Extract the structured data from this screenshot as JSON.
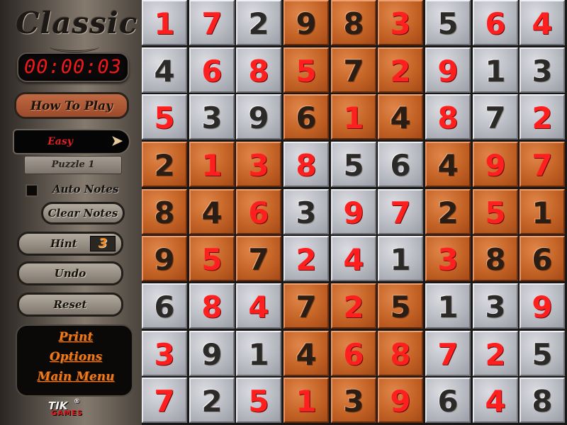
{
  "sidebar": {
    "title": "Classic",
    "timer": "00:00:03",
    "how_to_play": "How To Play",
    "difficulty": "Easy",
    "difficulty_arrow_icon": "arrow-right-icon",
    "puzzle_label": "Puzzle   1",
    "auto_notes": {
      "label": "Auto Notes",
      "checked": false
    },
    "clear_notes": "Clear Notes",
    "hint": {
      "label": "Hint",
      "count": "3"
    },
    "undo": "Undo",
    "reset": "Reset",
    "menu": {
      "print": "Print",
      "options": "Options",
      "main_menu": "Main Menu"
    },
    "logo": {
      "tik": "TIK",
      "reg": "®",
      "games": "GAMES"
    }
  },
  "colors": {
    "entered_digit": "#ff1f1f",
    "given_digit": "#2c2a28",
    "light_tile": "#b9bbc3",
    "dark_tile": "#c46326",
    "timer_text": "#f01818",
    "menu_link": "#f07a1a"
  },
  "board": {
    "rows": [
      [
        "1",
        "7",
        "2",
        "9",
        "8",
        "3",
        "5",
        "6",
        "4"
      ],
      [
        "4",
        "6",
        "8",
        "5",
        "7",
        "2",
        "9",
        "1",
        "3"
      ],
      [
        "5",
        "3",
        "9",
        "6",
        "1",
        "4",
        "8",
        "7",
        "2"
      ],
      [
        "2",
        "1",
        "3",
        "8",
        "5",
        "6",
        "4",
        "9",
        "7"
      ],
      [
        "8",
        "4",
        "6",
        "3",
        "9",
        "7",
        "2",
        "5",
        "1"
      ],
      [
        "9",
        "5",
        "7",
        "2",
        "4",
        "1",
        "3",
        "8",
        "6"
      ],
      [
        "6",
        "8",
        "4",
        "7",
        "2",
        "5",
        "1",
        "3",
        "9"
      ],
      [
        "3",
        "9",
        "1",
        "4",
        "6",
        "8",
        "7",
        "2",
        "5"
      ],
      [
        "7",
        "2",
        "5",
        "1",
        "3",
        "9",
        "6",
        "4",
        "8"
      ]
    ],
    "entered": [
      [
        1,
        1,
        0,
        0,
        0,
        1,
        0,
        1,
        1
      ],
      [
        0,
        1,
        1,
        1,
        0,
        1,
        1,
        0,
        0
      ],
      [
        1,
        0,
        0,
        0,
        1,
        0,
        1,
        0,
        1
      ],
      [
        0,
        1,
        1,
        1,
        0,
        0,
        0,
        1,
        1
      ],
      [
        0,
        0,
        1,
        0,
        1,
        1,
        0,
        1,
        0
      ],
      [
        0,
        1,
        0,
        1,
        1,
        0,
        1,
        0,
        0
      ],
      [
        0,
        1,
        1,
        0,
        1,
        0,
        0,
        0,
        1
      ],
      [
        1,
        0,
        0,
        0,
        1,
        1,
        1,
        1,
        0
      ],
      [
        1,
        0,
        1,
        1,
        0,
        1,
        0,
        1,
        0
      ]
    ]
  }
}
